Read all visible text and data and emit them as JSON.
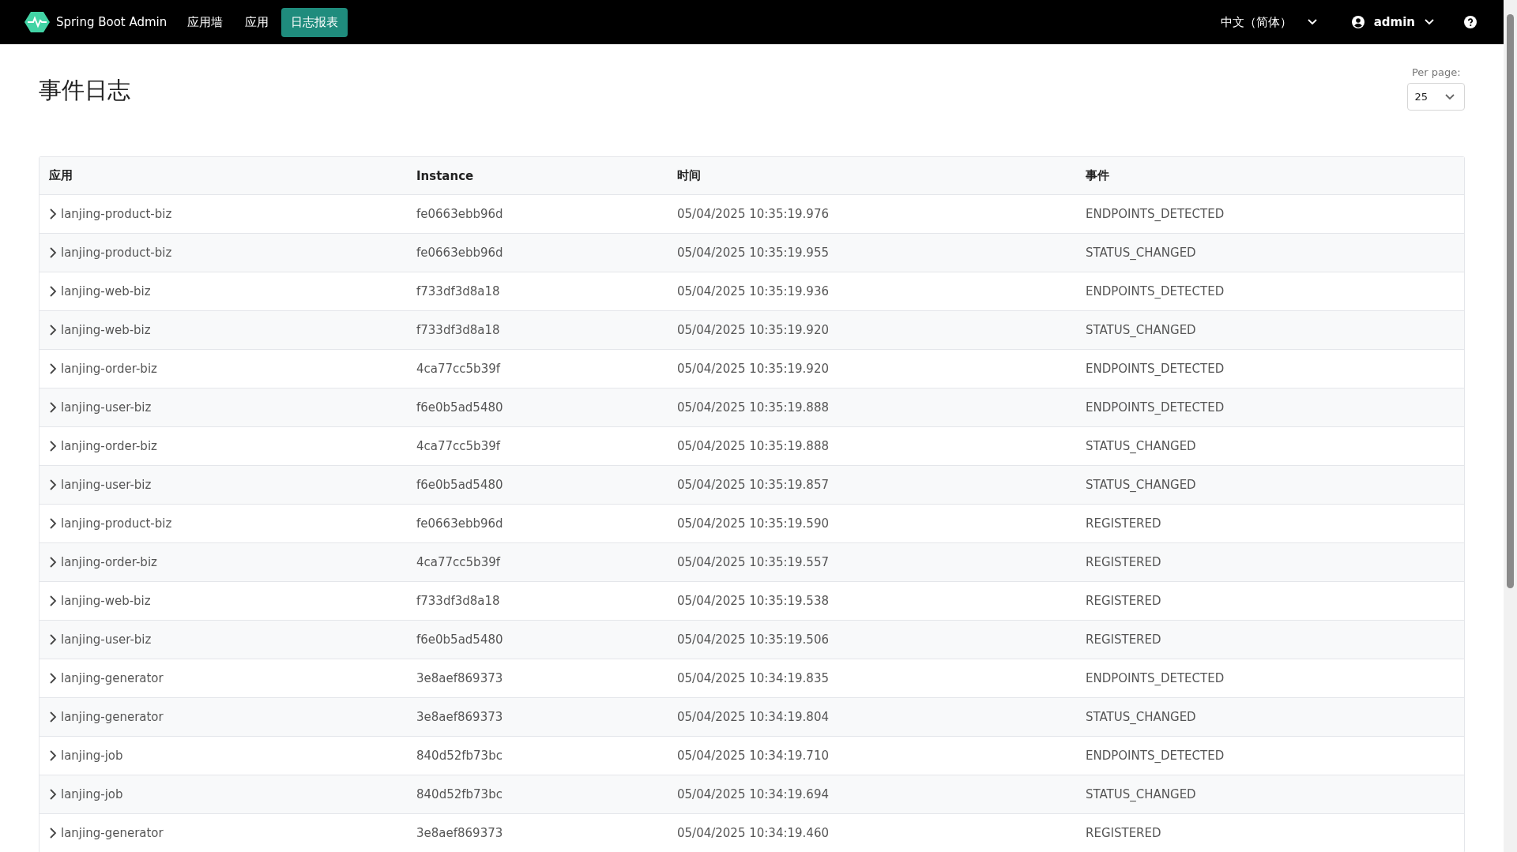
{
  "navbar": {
    "brand": "Spring Boot Admin",
    "links": [
      {
        "label": "应用墙",
        "selected": false
      },
      {
        "label": "应用",
        "selected": false
      },
      {
        "label": "日志报表",
        "selected": true
      }
    ],
    "language": "中文（简体）",
    "user": "admin"
  },
  "page": {
    "title": "事件日志",
    "per_page": {
      "label": "Per page:",
      "value": "25"
    }
  },
  "table": {
    "columns": [
      "应用",
      "Instance",
      "时间",
      "事件"
    ],
    "rows": [
      {
        "application": "lanjing-product-biz",
        "instance": "fe0663ebb96d",
        "time": "05/04/2025 10:35:19.976",
        "event": "ENDPOINTS_DETECTED",
        "expanded": false
      },
      {
        "application": "lanjing-product-biz",
        "instance": "fe0663ebb96d",
        "time": "05/04/2025 10:35:19.955",
        "event": "STATUS_CHANGED",
        "expanded": false
      },
      {
        "application": "lanjing-web-biz",
        "instance": "f733df3d8a18",
        "time": "05/04/2025 10:35:19.936",
        "event": "ENDPOINTS_DETECTED",
        "expanded": false
      },
      {
        "application": "lanjing-web-biz",
        "instance": "f733df3d8a18",
        "time": "05/04/2025 10:35:19.920",
        "event": "STATUS_CHANGED",
        "expanded": false
      },
      {
        "application": "lanjing-order-biz",
        "instance": "4ca77cc5b39f",
        "time": "05/04/2025 10:35:19.920",
        "event": "ENDPOINTS_DETECTED",
        "expanded": false
      },
      {
        "application": "lanjing-user-biz",
        "instance": "f6e0b5ad5480",
        "time": "05/04/2025 10:35:19.888",
        "event": "ENDPOINTS_DETECTED",
        "expanded": false
      },
      {
        "application": "lanjing-order-biz",
        "instance": "4ca77cc5b39f",
        "time": "05/04/2025 10:35:19.888",
        "event": "STATUS_CHANGED",
        "expanded": false
      },
      {
        "application": "lanjing-user-biz",
        "instance": "f6e0b5ad5480",
        "time": "05/04/2025 10:35:19.857",
        "event": "STATUS_CHANGED",
        "expanded": false
      },
      {
        "application": "lanjing-product-biz",
        "instance": "fe0663ebb96d",
        "time": "05/04/2025 10:35:19.590",
        "event": "REGISTERED",
        "expanded": false
      },
      {
        "application": "lanjing-order-biz",
        "instance": "4ca77cc5b39f",
        "time": "05/04/2025 10:35:19.557",
        "event": "REGISTERED",
        "expanded": false
      },
      {
        "application": "lanjing-web-biz",
        "instance": "f733df3d8a18",
        "time": "05/04/2025 10:35:19.538",
        "event": "REGISTERED",
        "expanded": false
      },
      {
        "application": "lanjing-user-biz",
        "instance": "f6e0b5ad5480",
        "time": "05/04/2025 10:35:19.506",
        "event": "REGISTERED",
        "expanded": false
      },
      {
        "application": "lanjing-generator",
        "instance": "3e8aef869373",
        "time": "05/04/2025 10:34:19.835",
        "event": "ENDPOINTS_DETECTED",
        "expanded": false
      },
      {
        "application": "lanjing-generator",
        "instance": "3e8aef869373",
        "time": "05/04/2025 10:34:19.804",
        "event": "STATUS_CHANGED",
        "expanded": false
      },
      {
        "application": "lanjing-job",
        "instance": "840d52fb73bc",
        "time": "05/04/2025 10:34:19.710",
        "event": "ENDPOINTS_DETECTED",
        "expanded": false
      },
      {
        "application": "lanjing-job",
        "instance": "840d52fb73bc",
        "time": "05/04/2025 10:34:19.694",
        "event": "STATUS_CHANGED",
        "expanded": false
      },
      {
        "application": "lanjing-generator",
        "instance": "3e8aef869373",
        "time": "05/04/2025 10:34:19.460",
        "event": "REGISTERED",
        "expanded": false
      }
    ]
  }
}
